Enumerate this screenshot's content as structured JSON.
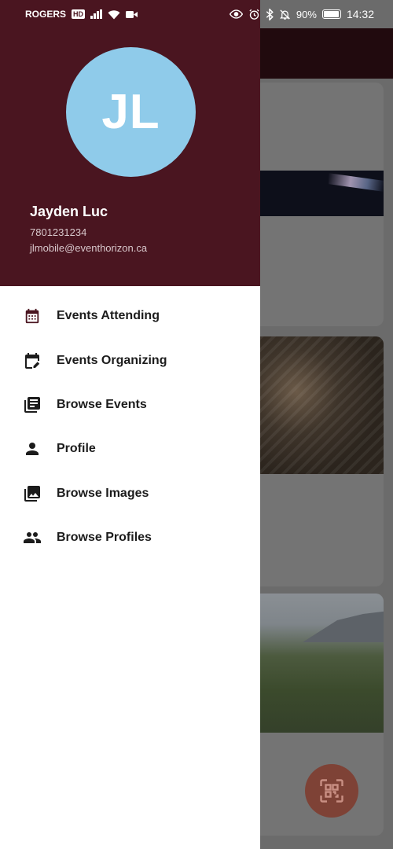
{
  "status_bar": {
    "carrier": "ROGERS",
    "hd_badge": "HD",
    "battery": "90%",
    "time": "14:32",
    "icons": [
      "signal-icon",
      "wifi-icon",
      "video-icon",
      "eye-icon",
      "alarm-icon",
      "bluetooth-icon",
      "mute-icon",
      "battery-icon"
    ]
  },
  "drawer": {
    "avatar_initials": "JL",
    "avatar_color": "#8fcbea",
    "header_color": "#4a1520",
    "user_name": "Jayden Luc",
    "user_phone": "7801231234",
    "user_email": "jlmobile@eventhorizon.ca",
    "menu": [
      {
        "label": "Events Attending",
        "icon": "calendar-icon"
      },
      {
        "label": "Events Organizing",
        "icon": "calendar-edit-icon"
      },
      {
        "label": "Browse Events",
        "icon": "library-books-icon"
      },
      {
        "label": "Profile",
        "icon": "person-icon"
      },
      {
        "label": "Browse Images",
        "icon": "photo-library-icon"
      },
      {
        "label": "Browse Profiles",
        "icon": "people-icon"
      }
    ]
  },
  "background": {
    "fab_icon": "qr-code-scan-icon"
  }
}
